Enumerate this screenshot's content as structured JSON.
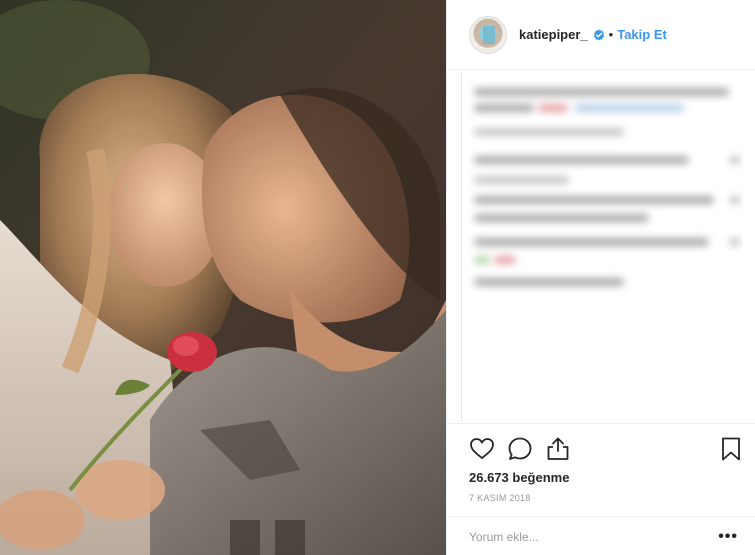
{
  "post": {
    "photo_alt": "",
    "header": {
      "username": "katiepiper_",
      "verified": true,
      "separator": "•",
      "follow_label": "Takip Et"
    },
    "actions": {
      "like_icon": "heart-icon",
      "comment_icon": "comment-icon",
      "share_icon": "share-icon",
      "save_icon": "bookmark-icon"
    },
    "likes_text": "26.673 beğenme",
    "date_text": "7 KASIM 2018",
    "comment_placeholder": "Yorum ekle...",
    "more_label": "•••"
  },
  "colors": {
    "follow_blue": "#3897f0",
    "text": "#262626",
    "muted": "#999999",
    "divider": "#efefef",
    "verified_blue": "#3897f0"
  }
}
